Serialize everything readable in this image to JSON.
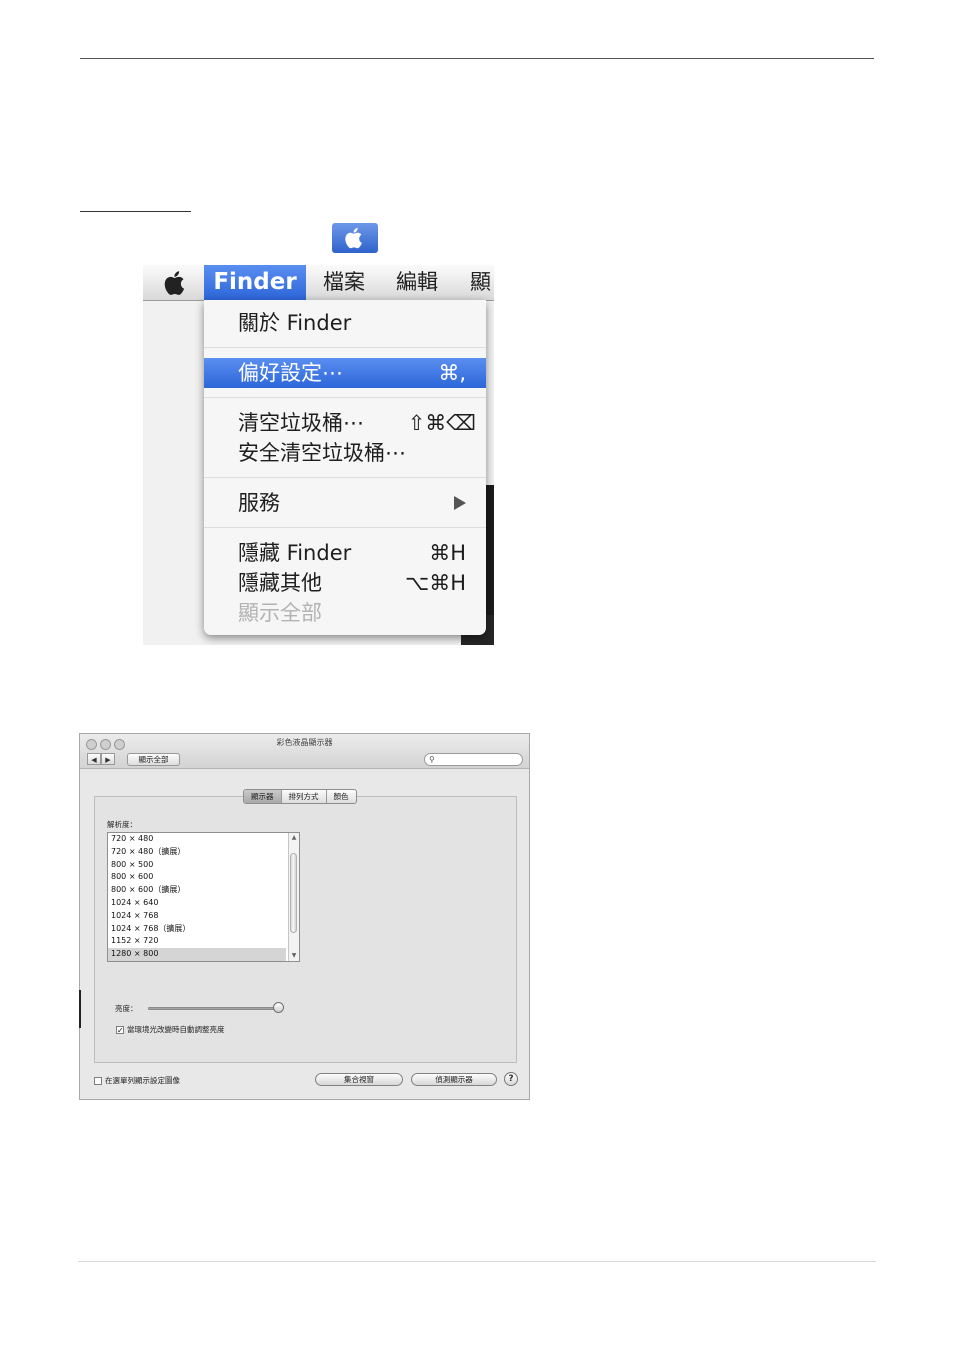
{
  "finder_menu": {
    "menubar": {
      "finder": "Finder",
      "file": "檔案",
      "edit": "編輯",
      "view_partial": "顯"
    },
    "items": {
      "about": "關於 Finder",
      "preferences": "偏好設定⋯",
      "preferences_shortcut": "⌘,",
      "empty_trash": "清空垃圾桶⋯",
      "empty_trash_shortcut": "⇧⌘⌫",
      "secure_empty_trash": "安全清空垃圾桶⋯",
      "services": "服務",
      "hide_finder": "隱藏 Finder",
      "hide_finder_shortcut": "⌘H",
      "hide_others": "隱藏其他",
      "hide_others_shortcut": "⌥⌘H",
      "show_all": "顯示全部"
    }
  },
  "display_prefs": {
    "window_title": "彩色液晶顯示器",
    "toolbar": {
      "back": "◀",
      "forward": "▶",
      "show_all": "顯示全部",
      "search_placeholder": ""
    },
    "tabs": [
      "顯示器",
      "排列方式",
      "顏色"
    ],
    "active_tab": 0,
    "resolution_label": "解析度：",
    "resolutions": [
      "720 × 480",
      "720 × 480（擴展）",
      "800 × 500",
      "800 × 600",
      "800 × 600（擴展）",
      "1024 × 640",
      "1024 × 768",
      "1024 × 768（擴展）",
      "1152 × 720",
      "1280 × 800"
    ],
    "selected_resolution_index": 9,
    "brightness_label": "亮度：",
    "brightness_level": 1.0,
    "auto_brightness": {
      "label": "當環境光改變時自動調整亮度",
      "checked": true
    },
    "show_in_menubar": {
      "label": "在選單列顯示設定圖像",
      "checked": false
    },
    "gather_windows": "集合視窗",
    "detect_displays": "偵測顯示器",
    "help": "?"
  }
}
